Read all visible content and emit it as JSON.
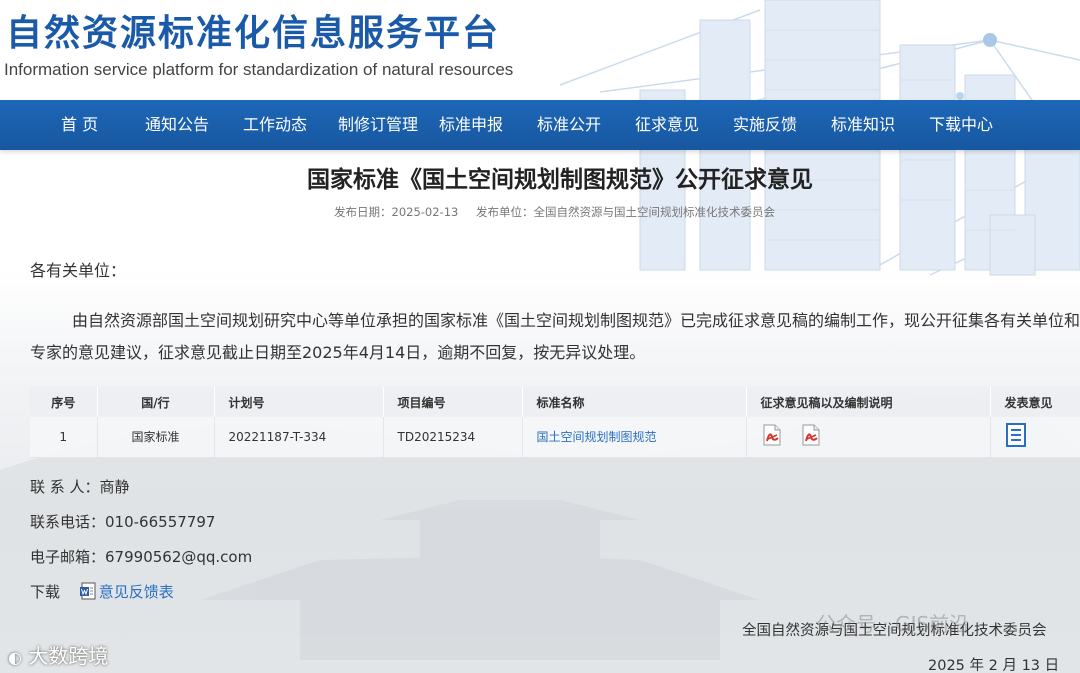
{
  "site": {
    "title": "自然资源标准化信息服务平台",
    "subtitle": "Information service platform for standardization of natural resources"
  },
  "nav": {
    "items": [
      "首 页",
      "通知公告",
      "工作动态",
      "制修订管理",
      "标准申报",
      "标准公开",
      "征求意见",
      "实施反馈",
      "标准知识",
      "下载中心"
    ]
  },
  "article": {
    "title": "国家标准《国土空间规划制图规范》公开征求意见",
    "publish_date": "发布日期：2025-02-13",
    "publisher": "发布单位：全国自然资源与国土空间规划标准化技术委员会",
    "greeting": "各有关单位：",
    "body": "由自然资源部国土空间规划研究中心等单位承担的国家标准《国土空间规划制图规范》已完成征求意见稿的编制工作，现公开征集各有关单位和专家的意见建议，征求意见截止日期至2025年4月14日，逾期不回复，按无异议处理。"
  },
  "table": {
    "headers": [
      "序号",
      "国/行",
      "计划号",
      "项目编号",
      "标准名称",
      "征求意见稿以及编制说明",
      "发表意见"
    ],
    "rows": [
      {
        "no": "1",
        "type": "国家标准",
        "plan_no": "20221187-T-334",
        "project_no": "TD20215234",
        "name": "国土空间规划制图规范"
      }
    ]
  },
  "contact": {
    "person_label": "联 系 人：",
    "person": "商静",
    "phone_label": "联系电话：",
    "phone": "010-66557797",
    "email_label": "电子邮箱：",
    "email": "67990562@qq.com",
    "download_label": "下载",
    "download_link": "意见反馈表"
  },
  "signature": {
    "org": "全国自然资源与国土空间规划标准化技术委员会",
    "date": "2025 年 2 月 13 日"
  },
  "watermarks": {
    "right": "公众号 · GIS前沿",
    "left": "大数跨境"
  },
  "colors": {
    "nav_bg": "#1d67b7",
    "title_blue": "#1b5aa8",
    "link_blue": "#2a6fc0",
    "pdf_red": "#d9342b"
  }
}
